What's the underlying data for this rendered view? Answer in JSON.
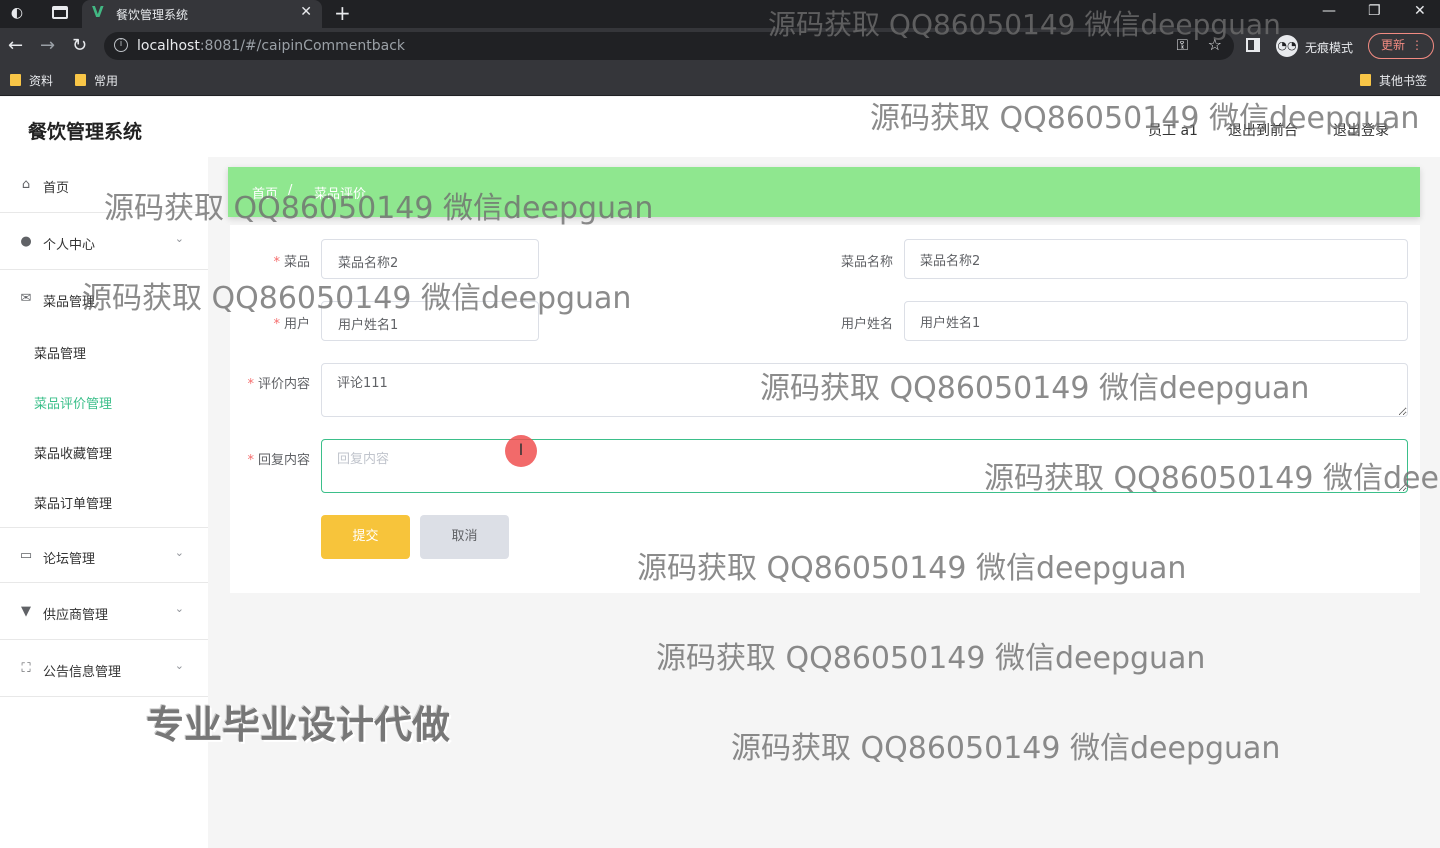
{
  "browser": {
    "tab_title": "餐饮管理系统",
    "url_host": "localhost",
    "url_rest": ":8081/#/caipinCommentback",
    "incognito_label": "无痕模式",
    "update_label": "更新",
    "bookmarks": [
      "资料",
      "常用"
    ],
    "other_bookmarks": "其他书签"
  },
  "header": {
    "title": "餐饮管理系统",
    "user": "员工 a1",
    "exit_front": "退出到前台",
    "logout": "退出登录"
  },
  "sidebar": {
    "home": "首页",
    "personal": "个人中心",
    "dish_mgmt": "菜品管理",
    "sub_items": [
      "菜品管理",
      "菜品评价管理",
      "菜品收藏管理",
      "菜品订单管理"
    ],
    "forum": "论坛管理",
    "supplier": "供应商管理",
    "notice": "公告信息管理"
  },
  "breadcrumb": {
    "home": "首页",
    "current": "菜品评价"
  },
  "form": {
    "dish_label": "菜品",
    "dish_value": "菜品名称2",
    "dish_name_label": "菜品名称",
    "dish_name_value": "菜品名称2",
    "user_label": "用户",
    "user_value": "用户姓名1",
    "user_name_label": "用户姓名",
    "user_name_value": "用户姓名1",
    "comment_label": "评价内容",
    "comment_value": "评论111",
    "reply_label": "回复内容",
    "reply_placeholder": "回复内容",
    "submit": "提交",
    "cancel": "取消"
  },
  "watermarks": {
    "text": "源码获取 QQ86050149 微信deepguan",
    "partial": "源码获取 QQ86050149 微信deep",
    "big": "专业毕业设计代做"
  },
  "colors": {
    "accent": "#3bbf8a",
    "breadcrumb_bg": "#8fe78f",
    "submit_bg": "#f7c43b",
    "required": "#f56c6c"
  }
}
